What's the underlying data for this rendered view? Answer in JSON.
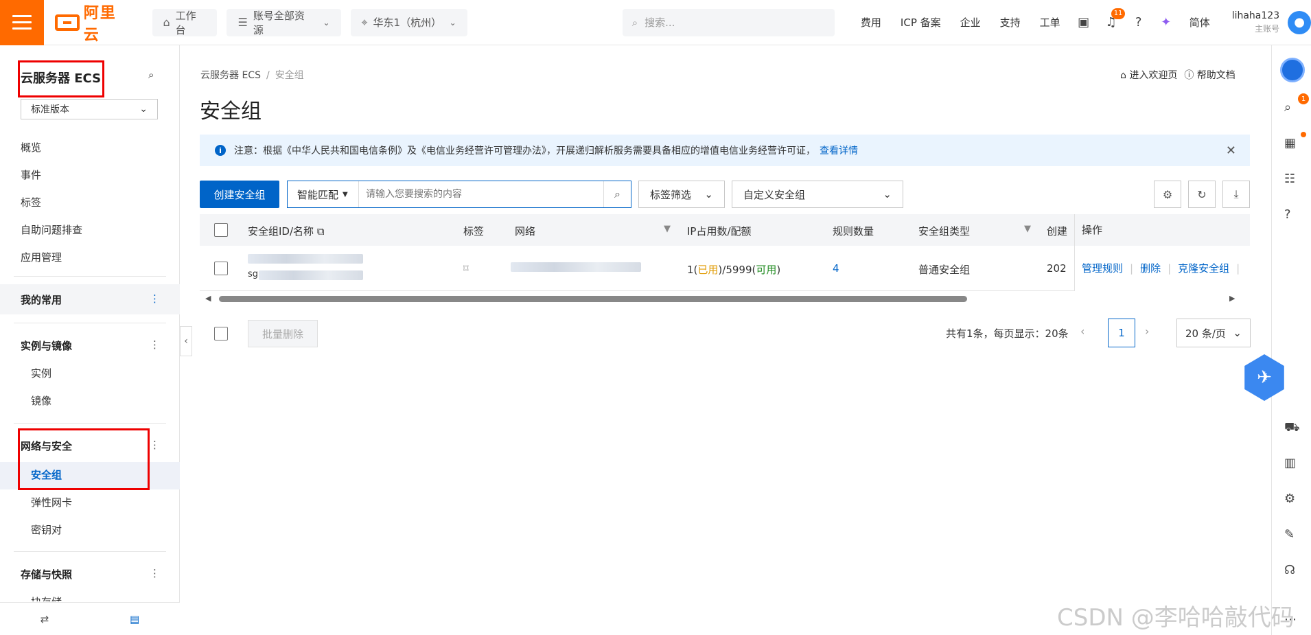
{
  "topbar": {
    "logo_text": "阿里云",
    "workbench": "工作台",
    "resources": "账号全部资源",
    "region": "华东1（杭州）",
    "search_placeholder": "搜索...",
    "links": [
      "费用",
      "ICP 备案",
      "企业",
      "支持",
      "工单"
    ],
    "notification_count": "11",
    "language": "简体",
    "user_name": "lihaha123",
    "user_role": "主账号"
  },
  "sidebar": {
    "title": "云服务器 ECS",
    "version": "标准版本",
    "top_items": [
      "概览",
      "事件",
      "标签",
      "自助问题排查",
      "应用管理"
    ],
    "favorites_group": "我的常用",
    "instances_group": "实例与镜像",
    "instances_items": [
      "实例",
      "镜像"
    ],
    "network_group": "网络与安全",
    "network_items": [
      "安全组",
      "弹性网卡",
      "密钥对"
    ],
    "storage_group": "存储与快照",
    "storage_partial": "块存储"
  },
  "main": {
    "breadcrumb": [
      "云服务器 ECS",
      "安全组"
    ],
    "title": "安全组",
    "welcome_link": "进入欢迎页",
    "help_link": "帮助文档",
    "notice_text": "注意：根据《中华人民共和国电信条例》及《电信业务经营许可管理办法》，开展递归解析服务需要具备相应的增值电信业务经营许可证，",
    "notice_link": "查看详情",
    "create_button": "创建安全组",
    "match_mode": "智能匹配",
    "search_placeholder": "请输入您要搜索的内容",
    "tag_filter": "标签筛选",
    "group_select": "自定义安全组"
  },
  "table": {
    "headers": {
      "id_name": "安全组ID/名称",
      "tag": "标签",
      "network": "网络",
      "ip": "IP占用数/配额",
      "rules": "规则数量",
      "type": "安全组类型",
      "created": "创建",
      "ops": "操作"
    },
    "row": {
      "id_prefix": "sg",
      "ip_used": "1",
      "ip_used_label": "已用",
      "ip_total": "5999",
      "ip_avail_label": "可用",
      "rules": "4",
      "type": "普通安全组",
      "created_partial": "202",
      "op_manage": "管理规则",
      "op_delete": "删除",
      "op_clone": "克隆安全组"
    }
  },
  "footer": {
    "bulk_delete": "批量删除",
    "pager_text": "共有1条，每页显示：20条",
    "current_page": "1",
    "page_size": "20 条/页"
  },
  "watermark": "CSDN @李哈哈敲代码",
  "colors": {
    "brand": "#ff6a00",
    "primary": "#0064c8",
    "used": "#e09a00",
    "available": "#1e8a1e",
    "highlight": "#e00000"
  }
}
